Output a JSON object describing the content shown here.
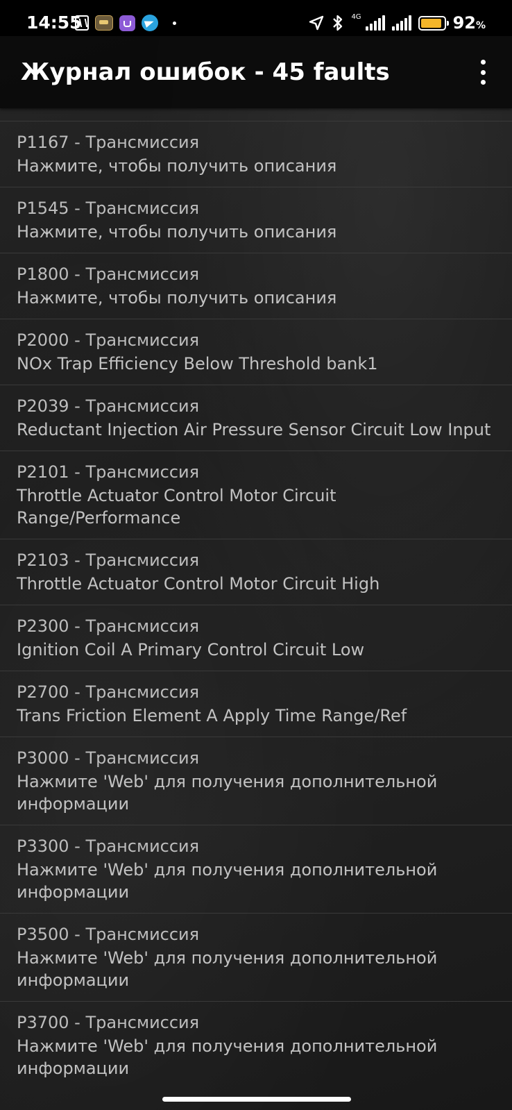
{
  "status_bar": {
    "time": "14:55",
    "network_label": "4G",
    "battery_percent": "92",
    "battery_unit": "%",
    "battery_level": 0.92,
    "battery_color": "#f3b52a"
  },
  "app_bar": {
    "title": "Журнал ошибок - 45 faults",
    "menu_icon": "more-vert-icon"
  },
  "faults": [
    {
      "code_label": "P1167 - Трансмиссия",
      "description": "Нажмите, чтобы получить описания"
    },
    {
      "code_label": "P1545 - Трансмиссия",
      "description": "Нажмите, чтобы получить описания"
    },
    {
      "code_label": "P1800 - Трансмиссия",
      "description": "Нажмите, чтобы получить описания"
    },
    {
      "code_label": "P2000 - Трансмиссия",
      "description": "NOx Trap Efficiency Below Threshold bank1"
    },
    {
      "code_label": "P2039 - Трансмиссия",
      "description": "Reductant Injection Air Pressure Sensor Circuit Low Input"
    },
    {
      "code_label": "P2101 - Трансмиссия",
      "description": "Throttle Actuator Control Motor Circuit Range/Performance"
    },
    {
      "code_label": "P2103 - Трансмиссия",
      "description": "Throttle Actuator Control Motor Circuit High"
    },
    {
      "code_label": "P2300 - Трансмиссия",
      "description": "Ignition Coil A Primary Control Circuit Low"
    },
    {
      "code_label": "P2700 - Трансмиссия",
      "description": "Trans Friction Element A Apply Time Range/Ref"
    },
    {
      "code_label": "P3000 - Трансмиссия",
      "description": "Нажмите 'Web' для получения дополнительной информации"
    },
    {
      "code_label": "P3300 - Трансмиссия",
      "description": "Нажмите 'Web' для получения дополнительной информации"
    },
    {
      "code_label": "P3500 - Трансмиссия",
      "description": "Нажмите 'Web' для получения дополнительной информации"
    },
    {
      "code_label": "P3700 - Трансмиссия",
      "description": "Нажмите 'Web' для получения дополнительной информации"
    }
  ]
}
